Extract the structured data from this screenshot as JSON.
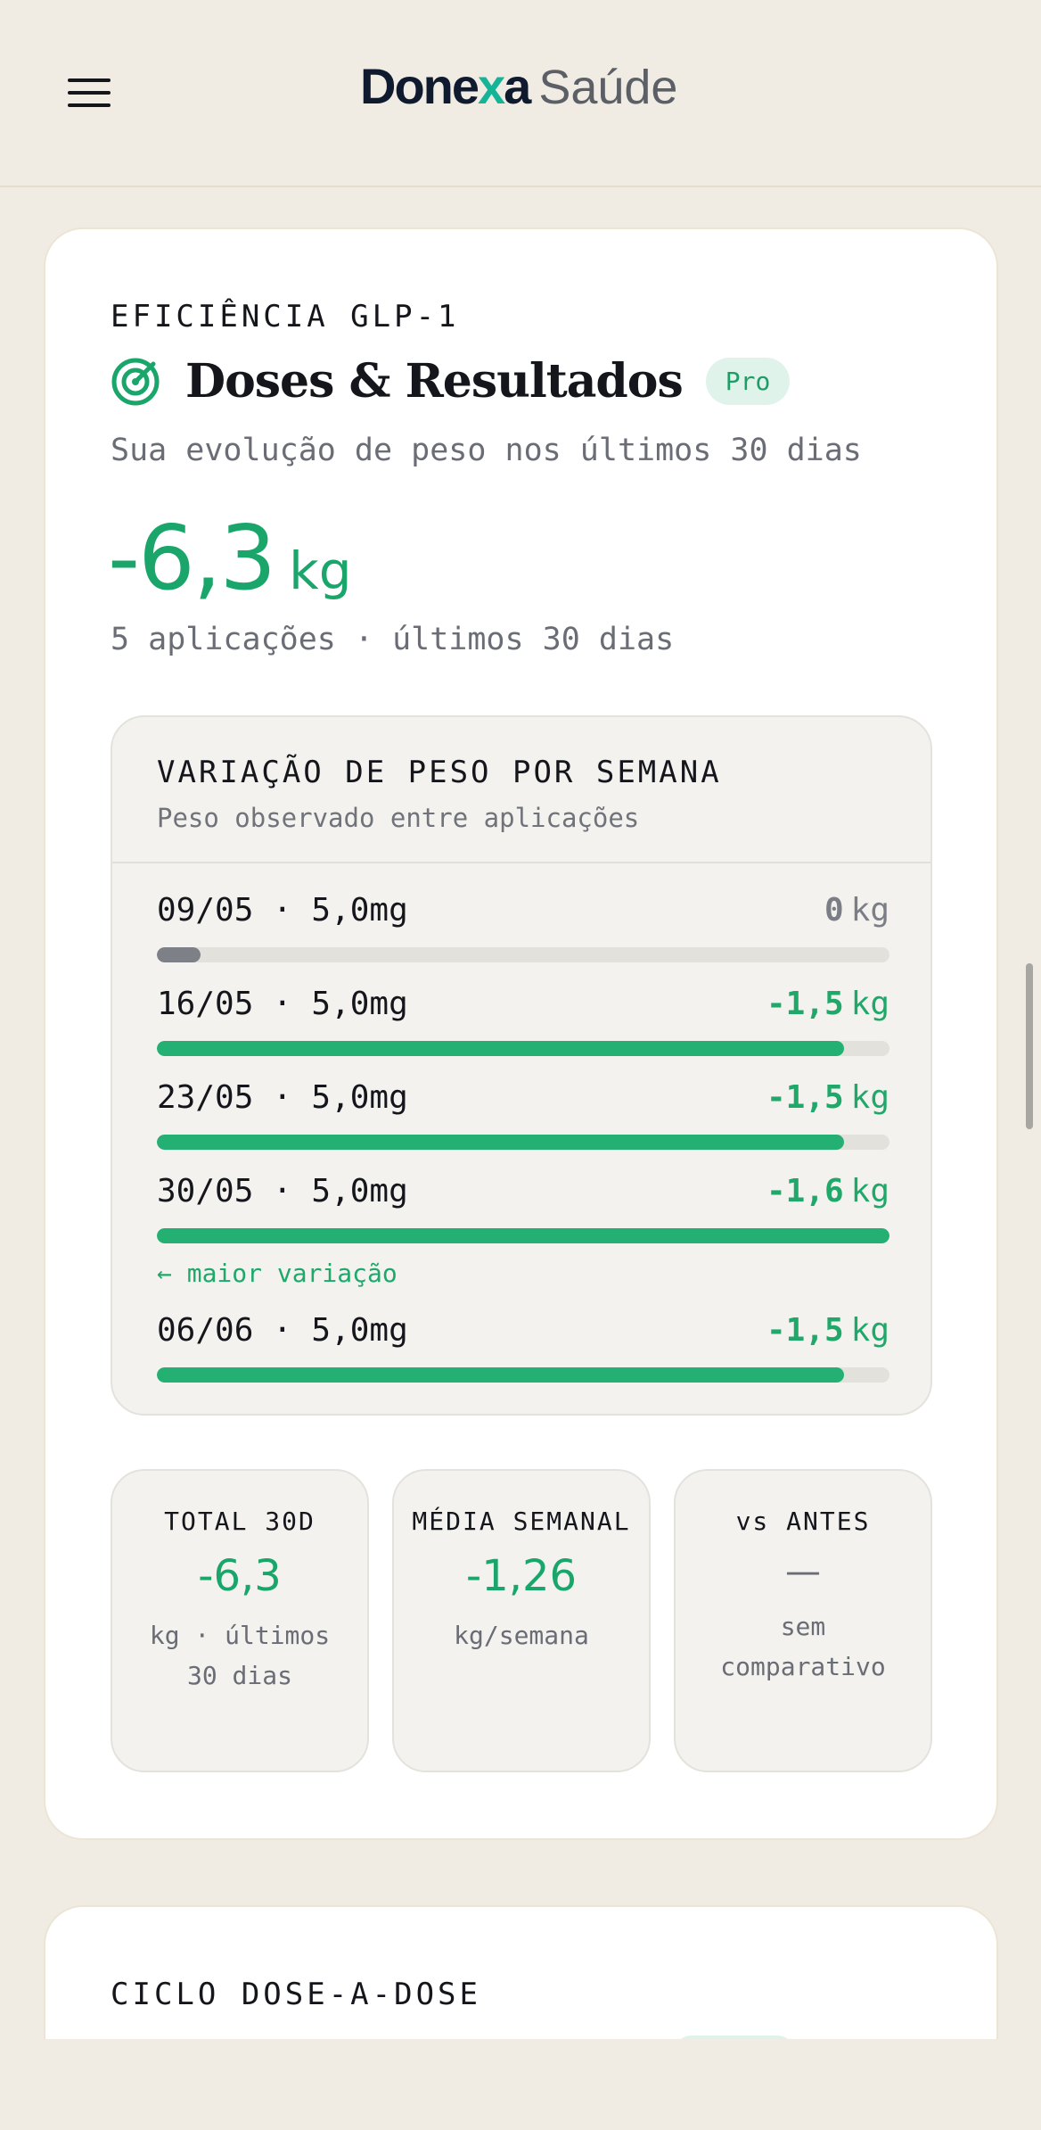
{
  "header": {
    "brand_main_a": "Done",
    "brand_main_x": "x",
    "brand_main_b": "a",
    "brand_sub": "Saúde",
    "menu_icon": "hamburger-menu-icon"
  },
  "efficiency_card": {
    "eyebrow": "EFICIÊNCIA GLP-1",
    "icon": "target-icon",
    "title": "Doses & Resultados",
    "badge": "Pro",
    "subtitle": "Sua evolução de peso nos últimos 30 dias",
    "total_value": "-6,3",
    "total_unit": "kg",
    "caption": "5 aplicações · últimos 30 dias",
    "weekly": {
      "title": "VARIAÇÃO DE PESO POR SEMANA",
      "subtitle": "Peso observado entre aplicações",
      "rows": [
        {
          "label": "09/05 · 5,0mg",
          "value": "0",
          "unit": "kg",
          "fill_fraction": 0.06,
          "neutral": true
        },
        {
          "label": "16/05 · 5,0mg",
          "value": "-1,5",
          "unit": "kg",
          "fill_fraction": 0.9375
        },
        {
          "label": "23/05 · 5,0mg",
          "value": "-1,5",
          "unit": "kg",
          "fill_fraction": 0.9375
        },
        {
          "label": "30/05 · 5,0mg",
          "value": "-1,6",
          "unit": "kg",
          "fill_fraction": 1.0,
          "note": "← maior variação"
        },
        {
          "label": "06/06 · 5,0mg",
          "value": "-1,5",
          "unit": "kg",
          "fill_fraction": 0.9375
        }
      ]
    },
    "stats": [
      {
        "label": "TOTAL 30D",
        "value": "-6,3",
        "note": "kg · últimos 30 dias"
      },
      {
        "label": "MÉDIA SEMANAL",
        "value": "-1,26",
        "note": "kg/semana"
      },
      {
        "label": "vs ANTES",
        "value": "—",
        "note": "sem comparativo"
      }
    ]
  },
  "cycle_card": {
    "eyebrow": "CICLO DOSE-A-DOSE"
  },
  "colors": {
    "background": "#f0ece4",
    "accent_green": "#1aa56b",
    "bar_green": "#24b072",
    "neutral_bar": "#7e8088",
    "badge_bg": "#e0f3ea",
    "brand_teal": "#16b497"
  }
}
